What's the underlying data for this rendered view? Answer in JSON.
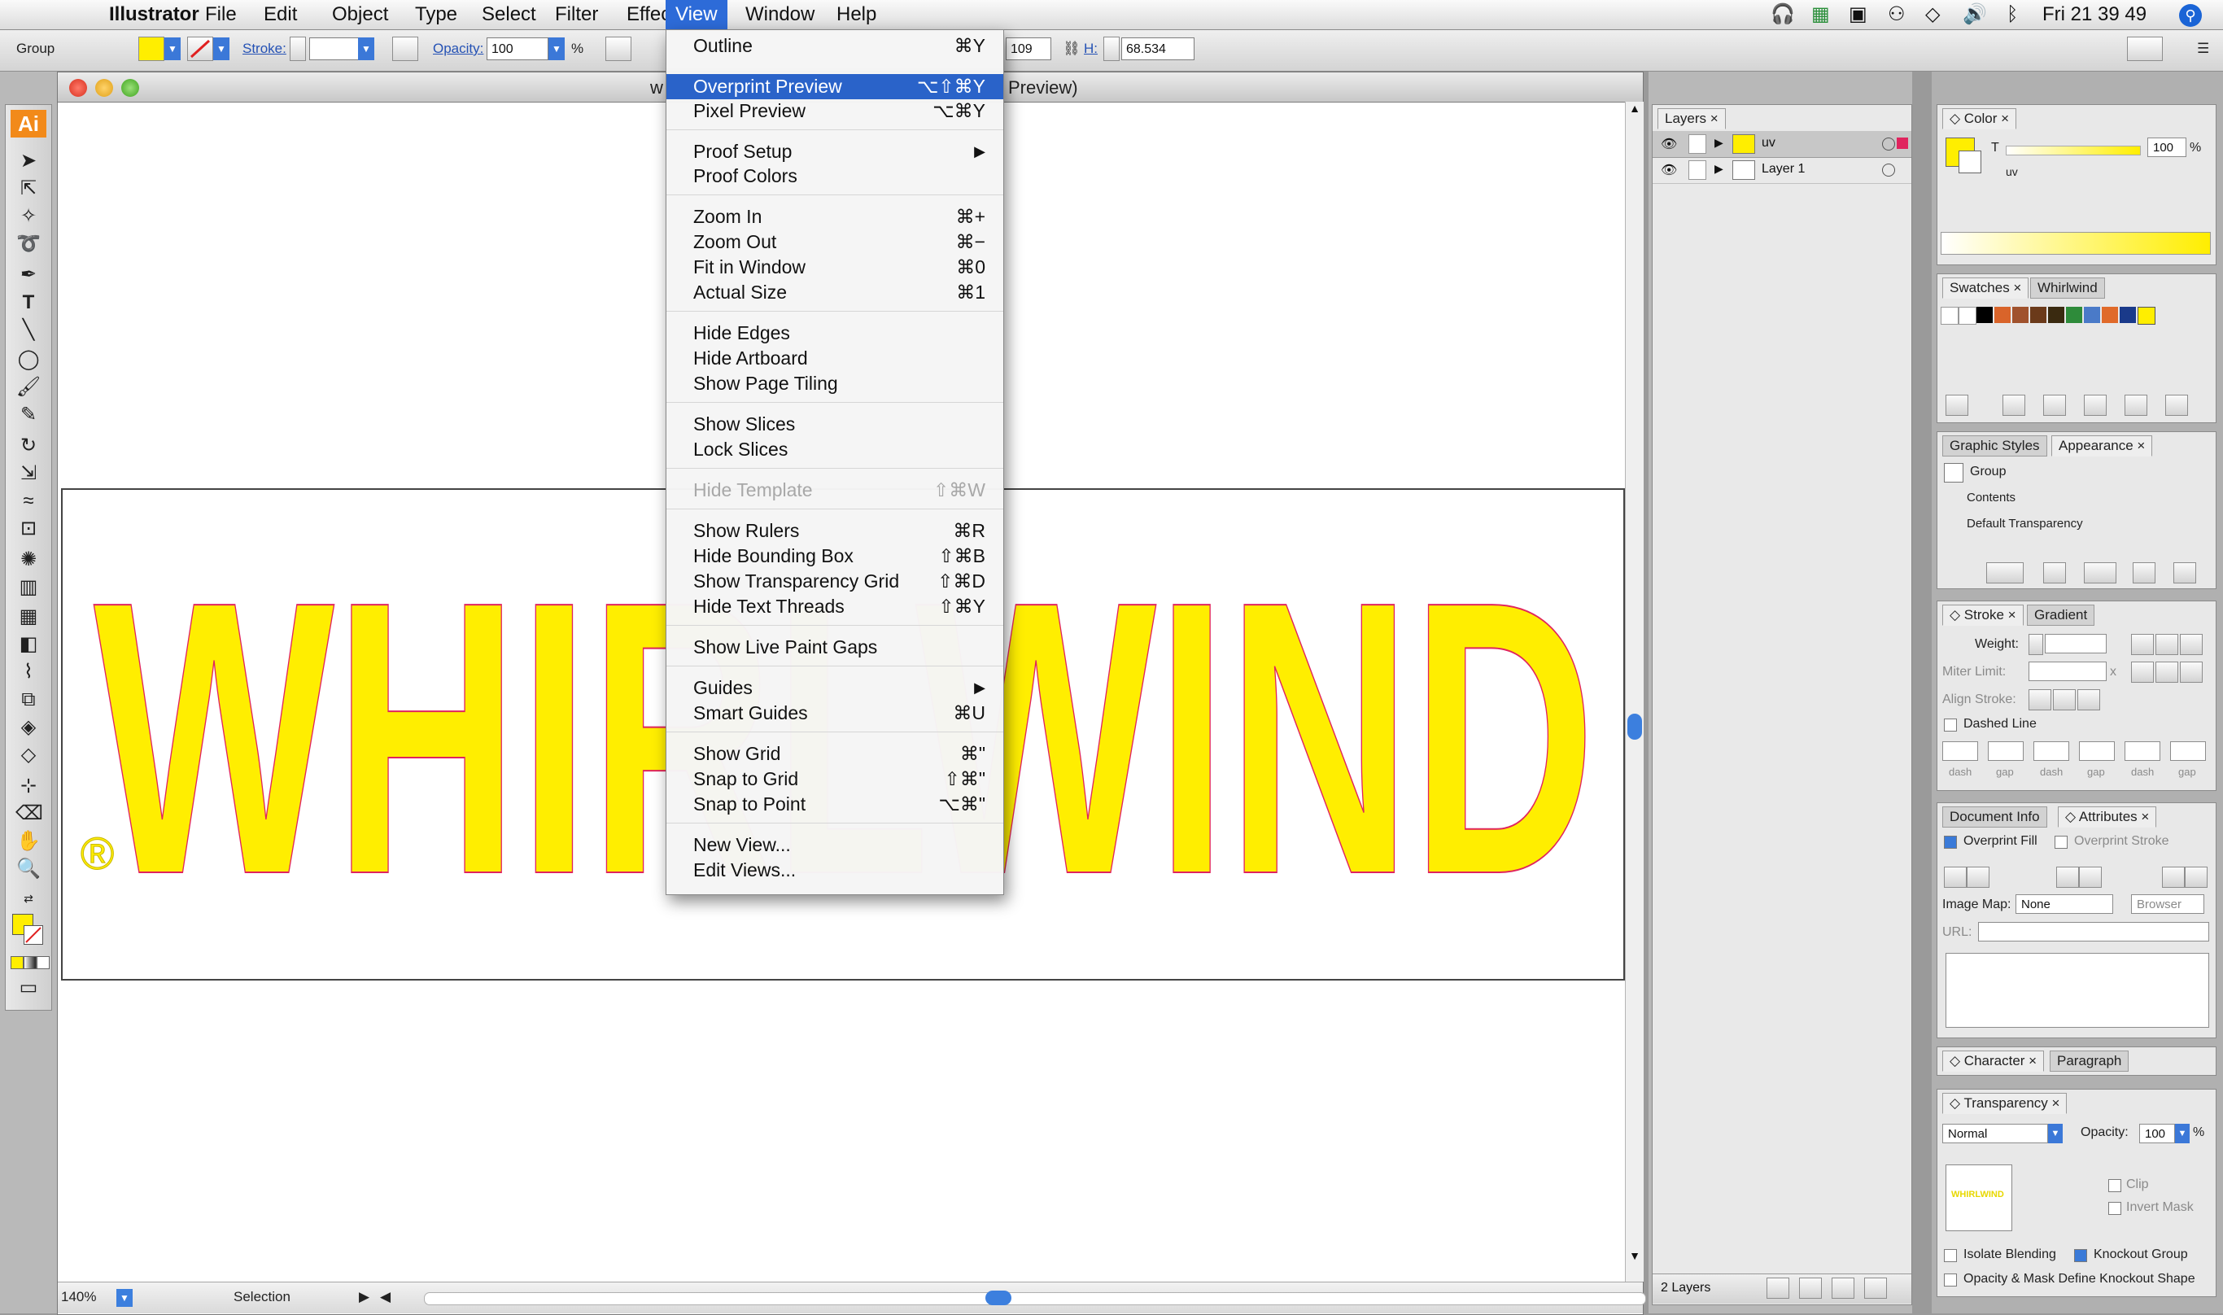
{
  "menubar": {
    "app": "Illustrator",
    "menus": [
      "File",
      "Edit",
      "Object",
      "Type",
      "Select",
      "Filter",
      "Effect",
      "View",
      "Window",
      "Help"
    ],
    "active": "View",
    "clock": "Fri 21 39 49"
  },
  "control_bar": {
    "selection_type": "Group",
    "stroke_label": "Stroke:",
    "opacity_label": "Opacity:",
    "opacity_value": "100",
    "percent": "%",
    "w_value": "109",
    "h_label": "H:",
    "h_value": "68.534"
  },
  "document": {
    "title_suffix": "Preview)",
    "title_prefix": "w",
    "artwork_text": "WHIRLWIND",
    "registered_mark": "®",
    "zoom": "140%",
    "status": "Selection",
    "artwork_fill": "#ffee00",
    "artwork_stroke": "#e0245e"
  },
  "view_menu": {
    "items": [
      {
        "label": "Outline",
        "shortcut": "⌘Y"
      },
      {
        "label": "Overprint Preview",
        "shortcut": "⌥⇧⌘Y",
        "highlighted": true
      },
      {
        "label": "Pixel Preview",
        "shortcut": "⌥⌘Y"
      },
      {
        "label": "Proof Setup",
        "submenu": true
      },
      {
        "label": "Proof Colors",
        "shortcut": ""
      },
      {
        "label": "Zoom In",
        "shortcut": "⌘+"
      },
      {
        "label": "Zoom Out",
        "shortcut": "⌘−"
      },
      {
        "label": "Fit in Window",
        "shortcut": "⌘0"
      },
      {
        "label": "Actual Size",
        "shortcut": "⌘1"
      },
      {
        "label": "Hide Edges",
        "shortcut": ""
      },
      {
        "label": "Hide Artboard",
        "shortcut": ""
      },
      {
        "label": "Show Page Tiling",
        "shortcut": ""
      },
      {
        "label": "Show Slices",
        "shortcut": ""
      },
      {
        "label": "Lock Slices",
        "shortcut": ""
      },
      {
        "label": "Hide Template",
        "shortcut": "⇧⌘W",
        "disabled": true
      },
      {
        "label": "Show Rulers",
        "shortcut": "⌘R"
      },
      {
        "label": "Hide Bounding Box",
        "shortcut": "⇧⌘B"
      },
      {
        "label": "Show Transparency Grid",
        "shortcut": "⇧⌘D"
      },
      {
        "label": "Hide Text Threads",
        "shortcut": "⇧⌘Y"
      },
      {
        "label": "Show Live Paint Gaps",
        "shortcut": ""
      },
      {
        "label": "Guides",
        "submenu": true
      },
      {
        "label": "Smart Guides",
        "shortcut": "⌘U"
      },
      {
        "label": "Show Grid",
        "shortcut": "⌘\""
      },
      {
        "label": "Snap to Grid",
        "shortcut": "⇧⌘\""
      },
      {
        "label": "Snap to Point",
        "shortcut": "⌥⌘\""
      },
      {
        "label": "New View...",
        "shortcut": ""
      },
      {
        "label": "Edit Views...",
        "shortcut": ""
      }
    ]
  },
  "layers_panel": {
    "tab": "Layers",
    "rows": [
      "uv",
      "Layer 1"
    ],
    "footer": "2 Layers"
  },
  "color_panel": {
    "tab": "Color",
    "channel": "T",
    "value": "100",
    "percent": "%",
    "swatch_name": "uv"
  },
  "swatches_panel": {
    "tabs": [
      "Swatches",
      "Whirlwind"
    ]
  },
  "appearance_panel": {
    "tabs": [
      "Graphic Styles",
      "Appearance"
    ],
    "rows": [
      "Group",
      "Contents",
      "Default Transparency"
    ]
  },
  "stroke_panel": {
    "tabs": [
      "Stroke",
      "Gradient"
    ],
    "weight_label": "Weight:",
    "miter_label": "Miter Limit:",
    "miter_x": "x",
    "align_label": "Align Stroke:",
    "dashed_label": "Dashed Line",
    "dash_labels": [
      "dash",
      "gap",
      "dash",
      "gap",
      "dash",
      "gap"
    ]
  },
  "attributes_panel": {
    "tabs": [
      "Document Info",
      "Attributes"
    ],
    "overprint_fill": "Overprint Fill",
    "overprint_stroke": "Overprint Stroke",
    "image_map_label": "Image Map:",
    "image_map_value": "None",
    "browser_label": "Browser",
    "url_label": "URL:"
  },
  "character_panel": {
    "tabs": [
      "Character",
      "Paragraph"
    ]
  },
  "transparency_panel": {
    "tab": "Transparency",
    "blend": "Normal",
    "opacity_label": "Opacity:",
    "opacity_value": "100",
    "percent": "%",
    "clip": "Clip",
    "invert": "Invert Mask",
    "isolate": "Isolate Blending",
    "knockout": "Knockout Group",
    "opacity_mask": "Opacity & Mask Define Knockout Shape",
    "thumb_text": "WHIRLWIND"
  },
  "colors": {
    "accent": "#2a63c9",
    "yellow": "#ffee00",
    "pink": "#e0245e",
    "ai_orange": "#f28a1a"
  }
}
